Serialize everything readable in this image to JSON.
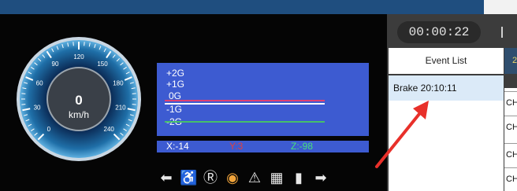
{
  "speedometer": {
    "speed": "0",
    "unit": "km/h",
    "ticks": [
      "0",
      "30",
      "60",
      "90",
      "120",
      "150",
      "180",
      "210",
      "240"
    ]
  },
  "gforce": {
    "levels": [
      "+2G",
      "+1G",
      "0G",
      "-1G",
      "-2G"
    ],
    "x_label": "X:-14",
    "y_label": "Y:3",
    "z_label": "Z:-98",
    "colors": {
      "x": "#ffffff",
      "y": "#e04040",
      "z": "#46e07a"
    }
  },
  "status_icons": [
    "left-arrow-icon",
    "seatbelt-icon",
    "parking-r-icon",
    "brake-warning-icon",
    "hazard-icon",
    "lane-icon",
    "door-icon",
    "right-arrow-icon"
  ],
  "right_panel": {
    "timer": "00:00:22",
    "event_list_header": "Event List",
    "event_list_right_header": "2",
    "events": [
      {
        "label": "Brake  20:10:11"
      }
    ],
    "channel_cells": [
      "CH",
      "CH",
      "CH",
      "CH"
    ]
  },
  "annotation": {
    "color": "#e8302a"
  }
}
